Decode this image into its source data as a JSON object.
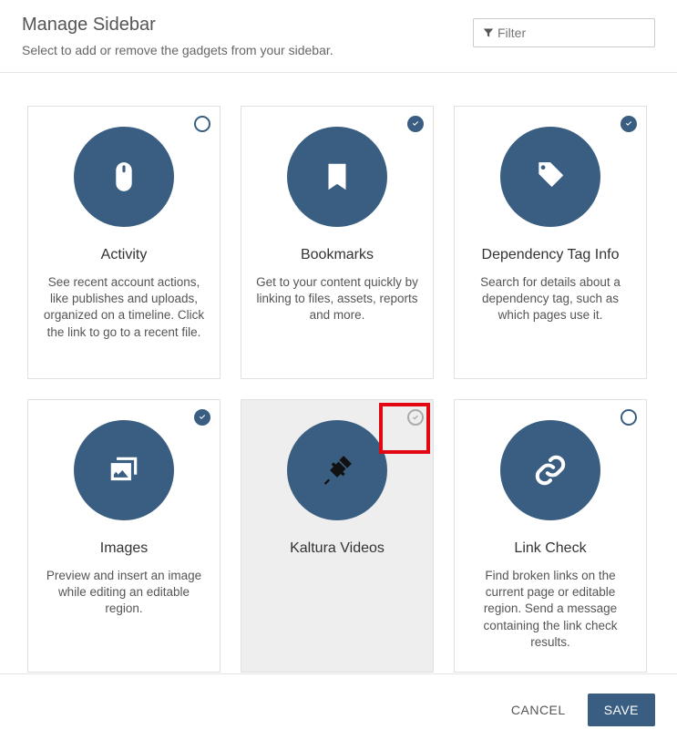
{
  "header": {
    "title": "Manage Sidebar",
    "subtitle": "Select to add or remove the gadgets from your sidebar."
  },
  "filter": {
    "placeholder": "Filter"
  },
  "cards": [
    {
      "title": "Activity",
      "desc": "See recent account actions, like publishes and uploads, organized on a timeline. Click the link to go to a recent file.",
      "state": "empty",
      "icon": "mouse"
    },
    {
      "title": "Bookmarks",
      "desc": "Get to your content quickly by linking to files, assets, reports and more.",
      "state": "full",
      "icon": "bookmark"
    },
    {
      "title": "Dependency Tag Info",
      "desc": "Search for details about a dependency tag, such as which pages use it.",
      "state": "full",
      "icon": "tag"
    },
    {
      "title": "Images",
      "desc": "Preview and insert an image while editing an editable region.",
      "state": "full",
      "icon": "images"
    },
    {
      "title": "Kaltura Videos",
      "desc": "",
      "state": "hover-empty",
      "icon": "plug",
      "hovered": true,
      "highlighted": true
    },
    {
      "title": "Link Check",
      "desc": "Find broken links on the current page or editable region. Send a message containing the link check results.",
      "state": "empty",
      "icon": "link"
    }
  ],
  "footer": {
    "cancel": "CANCEL",
    "save": "SAVE"
  }
}
